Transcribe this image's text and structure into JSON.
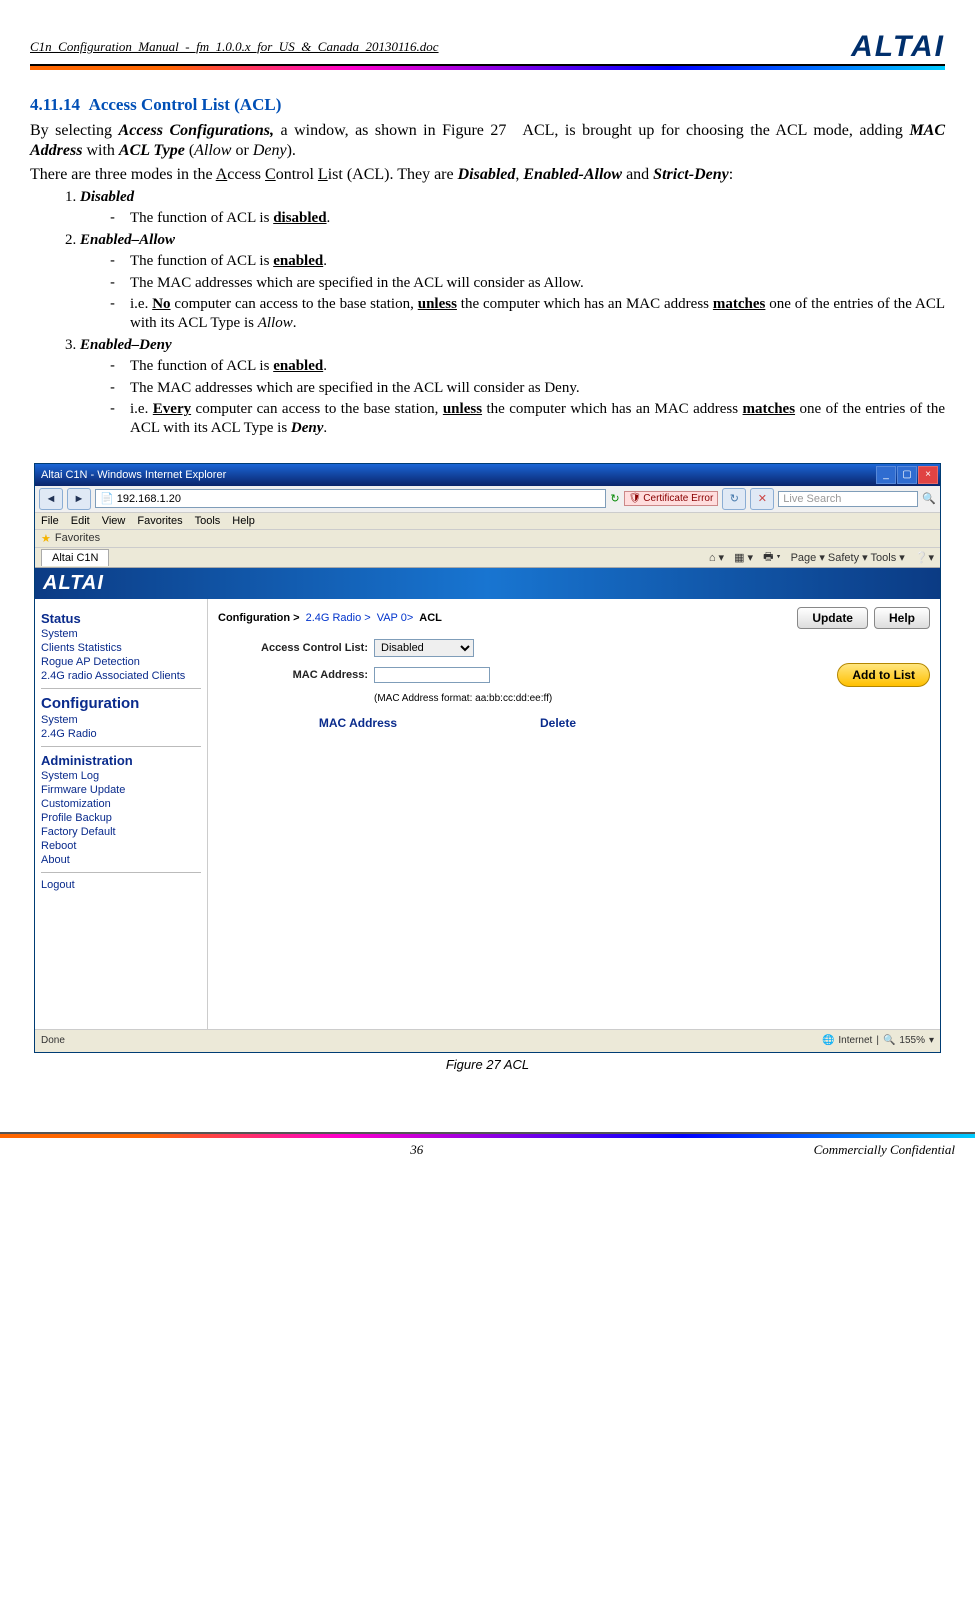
{
  "header": {
    "doc_filename": "C1n_Configuration_Manual_-_fm_1.0.0.x_for_US_&_Canada_20130116.doc",
    "brand": "ALTAI"
  },
  "section": {
    "number": "4.11.14",
    "title": "Access Control List (ACL)",
    "p1_a": "By selecting ",
    "p1_b": "Access Configurations,",
    "p1_c": " a window, as shown in Figure 27 ACL, is brought up for choosing the ACL mode, adding ",
    "p1_d": "MAC Address",
    "p1_e": " with ",
    "p1_f": "ACL Type",
    "p1_g": " (",
    "p1_h": "Allow",
    "p1_i": " or ",
    "p1_j": "Deny",
    "p1_k": ").",
    "p2_a": "There are three modes in the ",
    "p2_b": "A",
    "p2_c": "ccess ",
    "p2_d": "C",
    "p2_e": "ontrol ",
    "p2_f": "L",
    "p2_g": "ist (ACL). They are ",
    "p2_h": "Disabled",
    "p2_i": ", ",
    "p2_j": "Enabled-Allow",
    "p2_k": " and ",
    "p2_l": "Strict-Deny",
    "p2_m": ":",
    "modes": {
      "m1_label": "Disabled",
      "m1_a": "The function of ACL is ",
      "m1_b": "disabled",
      "m1_c": ".",
      "m2_label": "Enabled–Allow",
      "m2_1a": "The function of ACL is ",
      "m2_1b": "enabled",
      "m2_1c": ".",
      "m2_2": "The MAC addresses which are specified in the ACL will consider as Allow.",
      "m2_3a": "i.e. ",
      "m2_3b": "No",
      "m2_3c": " computer can access to the base station, ",
      "m2_3d": "unless",
      "m2_3e": " the computer which has an MAC address ",
      "m2_3f": "matches",
      "m2_3g": " one of the entries of the ACL with its ACL Type is ",
      "m2_3h": "Allow",
      "m2_3i": ".",
      "m3_label": "Enabled–Deny",
      "m3_1a": "The function of ACL is ",
      "m3_1b": "enabled",
      "m3_1c": ".",
      "m3_2": "The MAC addresses which are specified in the ACL will consider as Deny.",
      "m3_3a": "i.e. ",
      "m3_3b": "Every",
      "m3_3c": " computer can access to the base station, ",
      "m3_3d": "unless",
      "m3_3e": " the computer which has an MAC address ",
      "m3_3f": "matches",
      "m3_3g": " one of the entries of the ACL with its ACL Type is ",
      "m3_3h": "Deny",
      "m3_3i": "."
    }
  },
  "screenshot": {
    "window_title": "Altai C1N - Windows Internet Explorer",
    "url": "192.168.1.20",
    "cert_error": "Certificate Error",
    "search_placeholder": "Live Search",
    "menu": [
      "File",
      "Edit",
      "View",
      "Favorites",
      "Tools",
      "Help"
    ],
    "favorites_label": "Favorites",
    "tab_label": "Altai C1N",
    "tab_right": "Page ▾   Safety ▾   Tools ▾",
    "logo": "ALTAI",
    "sidebar": {
      "status": "Status",
      "status_items": [
        "System",
        "Clients Statistics",
        "Rogue AP Detection",
        "2.4G radio Associated Clients"
      ],
      "config": "Configuration",
      "config_items": [
        "System",
        "2.4G Radio"
      ],
      "admin": "Administration",
      "admin_items": [
        "System Log",
        "Firmware Update",
        "Customization",
        "Profile Backup",
        "Factory Default",
        "Reboot",
        "About"
      ],
      "logout": "Logout"
    },
    "breadcrumb": {
      "a": "Configuration >",
      "b": "2.4G Radio >",
      "c": "VAP 0>",
      "d": "ACL"
    },
    "buttons": {
      "update": "Update",
      "help": "Help",
      "add": "Add to List"
    },
    "form": {
      "acl_label": "Access Control List:",
      "acl_value": "Disabled",
      "mac_label": "MAC Address:",
      "mac_hint": "(MAC Address format: aa:bb:cc:dd:ee:ff)"
    },
    "table": {
      "col1": "MAC Address",
      "col2": "Delete"
    },
    "status_bar": {
      "done": "Done",
      "zone": "Internet",
      "zoom": "155%"
    }
  },
  "figure_caption": "Figure 27    ACL",
  "footer": {
    "page": "36",
    "conf": "Commercially Confidential"
  }
}
